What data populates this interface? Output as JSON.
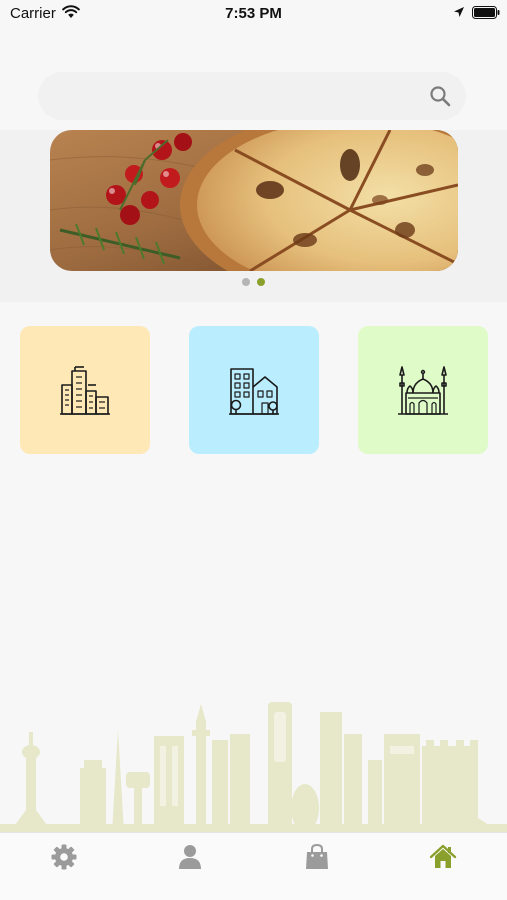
{
  "status_bar": {
    "carrier": "Carrier",
    "time": "7:53 PM"
  },
  "search": {
    "placeholder": "",
    "value": "",
    "icon": "search-icon"
  },
  "banner": {
    "image": "pizza-with-tomatoes-banner",
    "page_count": 2,
    "active_page": 1
  },
  "categories": [
    {
      "icon": "city-buildings-icon",
      "color": "#fde8b6"
    },
    {
      "icon": "hotel-buildings-icon",
      "color": "#baeefe"
    },
    {
      "icon": "mosque-icon",
      "color": "#dffbc8"
    }
  ],
  "tab_bar": {
    "items": [
      {
        "icon": "settings-gear-icon",
        "active": false
      },
      {
        "icon": "profile-person-icon",
        "active": false
      },
      {
        "icon": "shopping-bag-icon",
        "active": false
      },
      {
        "icon": "home-icon",
        "active": true
      }
    ],
    "active_color": "#8aa02d",
    "inactive_color": "#9b9b9b"
  },
  "colors": {
    "accent": "#8aa02d",
    "skyline": "#e6e8c9",
    "background": "#f7f7f7"
  }
}
